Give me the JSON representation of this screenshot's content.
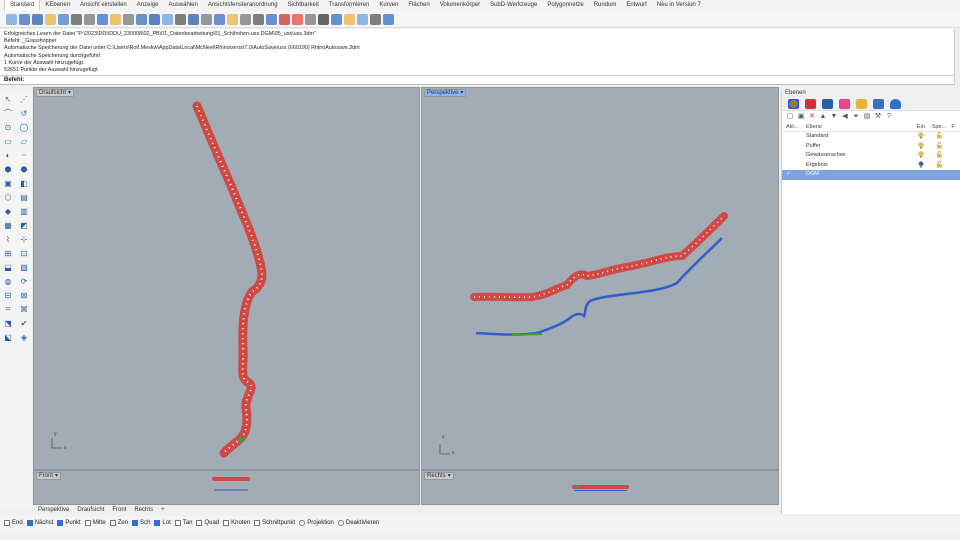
{
  "menu": {
    "tabs": [
      "Standard",
      "KEbenen",
      "Ansicht einstellen",
      "Anzeige",
      "Auswählen",
      "Ansichtsfensteranordnung",
      "Sichtbarkeit",
      "Transformieren",
      "Kurven",
      "Flächen",
      "Volumenkörper",
      "SubD-Werkzeuge",
      "Polygonnetze",
      "Rundum",
      "Entwurf",
      "Neu in Version 7"
    ],
    "active_index": 0
  },
  "command_history": [
    "Erfolgreiches Lesen der Datei \"P:\\2023\\DDI\\DDU_230008\\02_PB\\01_Datenbearbeitung\\01_Schlhohen-uss DGM\\05_uss\\uss.3dm\"",
    "Befehl: _Grasshopper",
    "Automatische Speicherung der Datei unter C:\\Users\\Rolf.Meskw\\AppData\\Local\\McNeel\\Rhinoceros\\7.0\\AutoSave\\uss (660190) RhinoAutosave.3dm",
    "Automatische Speicherung durchgeführt",
    "1 Kurve der Auswahl hinzugefügt.",
    "52651 Punkte der Auswahl hinzugefügt."
  ],
  "command_prompt": "Befehl:",
  "viewports": {
    "top": {
      "title": "Draufsicht"
    },
    "perspective": {
      "title": "Perspektive"
    },
    "front": {
      "title": "Front"
    },
    "right": {
      "title": "Rechts"
    }
  },
  "viewport_tabs": [
    "Perspektive",
    "Draufsicht",
    "Front",
    "Rechts",
    "+"
  ],
  "snaps": [
    {
      "label": "End",
      "checked": false
    },
    {
      "label": "Nächst",
      "checked": true
    },
    {
      "label": "Punkt",
      "checked": true
    },
    {
      "label": "Mitte",
      "checked": false
    },
    {
      "label": "Zen",
      "checked": false
    },
    {
      "label": "Sch",
      "checked": true
    },
    {
      "label": "Lot",
      "checked": true
    },
    {
      "label": "Tan",
      "checked": false
    },
    {
      "label": "Quad",
      "checked": false
    },
    {
      "label": "Knoten",
      "checked": false
    },
    {
      "label": "Schnittpunkt",
      "checked": false
    },
    {
      "label": "Projektion",
      "radio": true
    },
    {
      "label": "Deaktivieren",
      "radio": true
    }
  ],
  "layers_panel": {
    "title": "Ebenen",
    "columns": {
      "akt": "Akt...",
      "ebene": "Ebene",
      "ein": "Ein",
      "spe": "Spe...",
      "f": "F"
    },
    "rows": [
      {
        "name": "Standard",
        "selected": false,
        "current": false
      },
      {
        "name": "Puffer",
        "selected": false,
        "current": false
      },
      {
        "name": "Gewässerachse",
        "selected": false,
        "current": false
      },
      {
        "name": "Ergebnis",
        "selected": false,
        "current": false
      },
      {
        "name": "DGM",
        "selected": true,
        "current": true
      }
    ],
    "current_mark": "✓"
  },
  "axis_labels": {
    "x": "x",
    "y": "y",
    "z": "z"
  },
  "colors": {
    "viewport_bg": "#a3acb5",
    "points": "#cf4a45",
    "curve_blue": "#2f5ec8",
    "curve_green": "#3ca03c",
    "selected_row": "#7fa3e0"
  }
}
